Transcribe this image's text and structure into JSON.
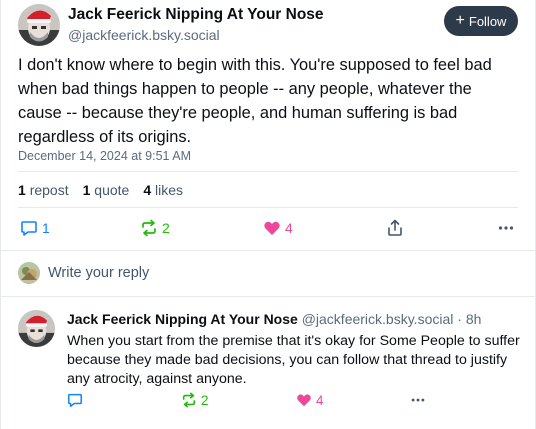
{
  "post": {
    "display_name": "Jack Feerick Nipping At Your Nose",
    "handle": "@jackfeerick.bsky.social",
    "follow_label": "Follow",
    "text": "I don't know where to begin with this. You're supposed to feel bad when bad things happen to people -- any people, whatever the cause -- because they're people, and human suffering is bad regardless of its origins.",
    "timestamp": "December 14, 2024 at 9:51 AM",
    "stats": {
      "reposts_count": "1",
      "reposts_label": "repost",
      "quotes_count": "1",
      "quotes_label": "quote",
      "likes_count": "4",
      "likes_label": "likes"
    },
    "actions": {
      "replies": "1",
      "reposts": "2",
      "likes": "4"
    }
  },
  "reply_box": {
    "placeholder": "Write your reply"
  },
  "reply": {
    "display_name": "Jack Feerick Nipping At Your Nose",
    "handle": "@jackfeerick.bsky.social",
    "age": "· 8h",
    "text": "When you start from the premise that it's okay for Some People to suffer because they made bad decisions, you can follow that thread to justify any atrocity, against anyone.",
    "actions": {
      "reposts": "2",
      "likes": "4"
    }
  },
  "colors": {
    "accent_blue": "#1083fe",
    "repost_green": "#20bc07",
    "like_pink": "#ec4899",
    "follow_bg": "#2d3a49"
  }
}
